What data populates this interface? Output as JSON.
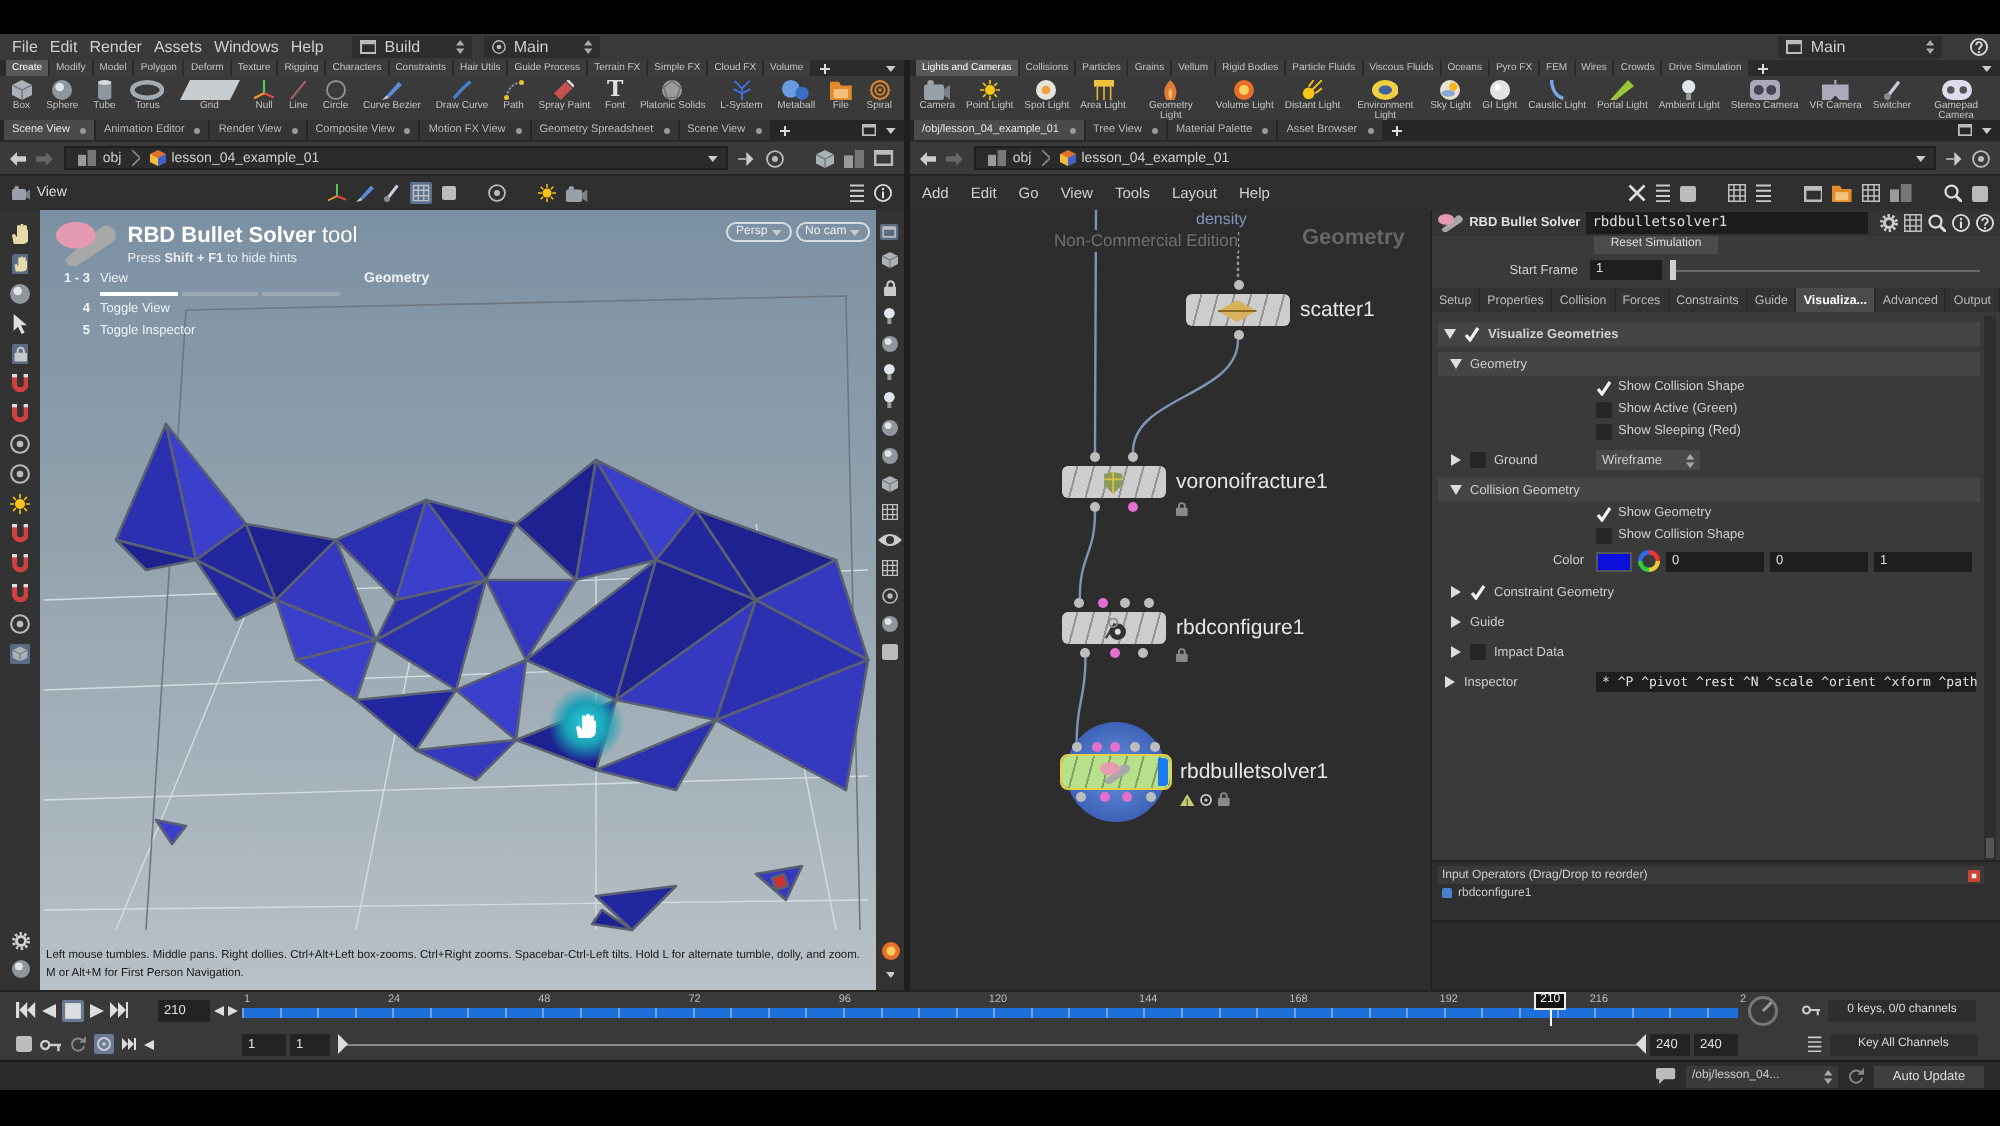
{
  "menubar": {
    "menus": [
      "File",
      "Edit",
      "Render",
      "Assets",
      "Windows",
      "Help"
    ],
    "desktop": "Build",
    "left_context": "Main",
    "right_context": "Main"
  },
  "shelf_left": {
    "tabs": [
      {
        "label": "Create",
        "selected": true
      },
      {
        "label": "Modify",
        "selected": false
      },
      {
        "label": "Model",
        "selected": false
      },
      {
        "label": "Polygon",
        "selected": false
      },
      {
        "label": "Deform",
        "selected": false
      },
      {
        "label": "Texture",
        "selected": false
      },
      {
        "label": "Rigging",
        "selected": false
      },
      {
        "label": "Characters",
        "selected": false
      },
      {
        "label": "Constraints",
        "selected": false
      },
      {
        "label": "Hair Utils",
        "selected": false
      },
      {
        "label": "Guide Process",
        "selected": false
      },
      {
        "label": "Terrain FX",
        "selected": false
      },
      {
        "label": "Simple FX",
        "selected": false
      },
      {
        "label": "Cloud FX",
        "selected": false
      },
      {
        "label": "Volume",
        "selected": false
      }
    ],
    "tools": [
      {
        "label": "Box"
      },
      {
        "label": "Sphere"
      },
      {
        "label": "Tube"
      },
      {
        "label": "Torus"
      },
      {
        "label": "Grid"
      },
      {
        "label": "Null"
      },
      {
        "label": "Line"
      },
      {
        "label": "Circle"
      },
      {
        "label": "Curve Bezier"
      },
      {
        "label": "Draw Curve"
      },
      {
        "label": "Path"
      },
      {
        "label": "Spray Paint"
      },
      {
        "label": "Font",
        "glyph": "T"
      },
      {
        "label": "Platonic Solids"
      },
      {
        "label": "L-System"
      },
      {
        "label": "Metaball"
      },
      {
        "label": "File"
      },
      {
        "label": "Spiral"
      }
    ]
  },
  "shelf_right": {
    "tabs": [
      {
        "label": "Lights and Cameras",
        "selected": true
      },
      {
        "label": "Collisions",
        "selected": false
      },
      {
        "label": "Particles",
        "selected": false
      },
      {
        "label": "Grains",
        "selected": false
      },
      {
        "label": "Vellum",
        "selected": false
      },
      {
        "label": "Rigid Bodies",
        "selected": false
      },
      {
        "label": "Particle Fluids",
        "selected": false
      },
      {
        "label": "Viscous Fluids",
        "selected": false
      },
      {
        "label": "Oceans",
        "selected": false
      },
      {
        "label": "Pyro FX",
        "selected": false
      },
      {
        "label": "FEM",
        "selected": false
      },
      {
        "label": "Wires",
        "selected": false
      },
      {
        "label": "Crowds",
        "selected": false
      },
      {
        "label": "Drive Simulation",
        "selected": false
      }
    ],
    "tools": [
      {
        "label": "Camera"
      },
      {
        "label": "Point Light"
      },
      {
        "label": "Spot Light"
      },
      {
        "label": "Area Light"
      },
      {
        "label": "Geometry Light"
      },
      {
        "label": "Volume Light"
      },
      {
        "label": "Distant Light"
      },
      {
        "label": "Environment Light"
      },
      {
        "label": "Sky Light"
      },
      {
        "label": "GI Light"
      },
      {
        "label": "Caustic Light"
      },
      {
        "label": "Portal Light"
      },
      {
        "label": "Ambient Light"
      },
      {
        "label": "Stereo Camera"
      },
      {
        "label": "VR Camera"
      },
      {
        "label": "Switcher"
      },
      {
        "label": "Gamepad Camera"
      }
    ]
  },
  "pane_left": {
    "tabs": [
      {
        "label": "Scene View",
        "selected": true
      },
      {
        "label": "Animation Editor",
        "selected": false
      },
      {
        "label": "Render View",
        "selected": false
      },
      {
        "label": "Composite View",
        "selected": false
      },
      {
        "label": "Motion FX View",
        "selected": false
      },
      {
        "label": "Geometry Spreadsheet",
        "selected": false
      },
      {
        "label": "Scene View",
        "selected": false
      }
    ],
    "path": [
      "obj",
      "lesson_04_example_01"
    ],
    "toolbar_title": "View"
  },
  "pane_right": {
    "tabs": [
      {
        "label": "/obj/lesson_04_example_01",
        "selected": true
      },
      {
        "label": "Tree View",
        "selected": false
      },
      {
        "label": "Material Palette",
        "selected": false
      },
      {
        "label": "Asset Browser",
        "selected": false
      }
    ],
    "path": [
      "obj",
      "lesson_04_example_01"
    ],
    "menus": [
      "Add",
      "Edit",
      "Go",
      "View",
      "Tools",
      "Layout",
      "Help"
    ]
  },
  "viewport": {
    "tool_hint": {
      "title": "**RBD Bullet Solver** tool",
      "subtitle": "Press **Shift + F1** to hide hints",
      "hotkeys": [
        {
          "keys": "1 - 3",
          "action": "View"
        },
        {
          "keys": "4",
          "action": "Toggle View"
        },
        {
          "keys": "5",
          "action": "Toggle Inspector"
        }
      ],
      "modes": [
        {
          "selected": true
        },
        {
          "selected": false
        },
        {
          "selected": false
        }
      ],
      "mode_label": "Geometry"
    },
    "camera_menus": [
      "Persp",
      "No cam"
    ],
    "help_lines": [
      "Left mouse tumbles. Middle pans. Right dollies. Ctrl+Alt+Left box-zooms. Ctrl+Right zooms. Spacebar-Ctrl-Left tilts. Hold L for alternate tumble, dolly, and zoom.",
      "M or Alt+M for First Person Navigation."
    ]
  },
  "network": {
    "partial_label": "density",
    "watermark": "Non-Commercial Edition",
    "context_label": "Geometry",
    "nodes": [
      {
        "name": "scatter1",
        "color": "#cdcdcd",
        "selected": false,
        "display": false,
        "locked": false,
        "simulation": false,
        "time_dependent": false
      },
      {
        "name": "voronoifracture1",
        "color": "#cdcdcd",
        "selected": false,
        "display": false,
        "locked": true,
        "simulation": false,
        "time_dependent": false
      },
      {
        "name": "rbdconfigure1",
        "color": "#cdcdcd",
        "selected": false,
        "display": false,
        "locked": true,
        "simulation": false,
        "time_dependent": false
      },
      {
        "name": "rbdbulletsolver1",
        "color": "#b7e08a",
        "selected": true,
        "display": true,
        "locked": true,
        "simulation": true,
        "time_dependent": true
      }
    ]
  },
  "parameters": {
    "node_type": "RBD Bullet Solver",
    "node_name": "rbdbulletsolver1",
    "reset_button": "Reset Simulation",
    "start_frame": {
      "label": "Start Frame",
      "value": "1",
      "level": 0
    },
    "tabs": [
      {
        "label": "Setup",
        "selected": false
      },
      {
        "label": "Properties",
        "selected": false
      },
      {
        "label": "Collision",
        "selected": false
      },
      {
        "label": "Forces",
        "selected": false
      },
      {
        "label": "Constraints",
        "selected": false
      },
      {
        "label": "Guide",
        "selected": false
      },
      {
        "label": "Visualiza...",
        "selected": true
      },
      {
        "label": "Advanced",
        "selected": false
      },
      {
        "label": "Output",
        "selected": false
      }
    ],
    "folders": [
      {
        "kind": "toggle_folder",
        "label": "Visualize Geometries",
        "expanded": true,
        "checked": true,
        "children": [
          {
            "kind": "folder",
            "label": "Geometry",
            "expanded": true,
            "children": [
              {
                "kind": "checkbox",
                "label": "Show Collision Shape",
                "checked": true
              },
              {
                "kind": "checkbox",
                "label": "Show Active (Green)",
                "checked": false
              },
              {
                "kind": "checkbox",
                "label": "Show Sleeping (Red)",
                "checked": false
              }
            ]
          },
          {
            "kind": "toggle_folder",
            "label": "Ground",
            "expanded": false,
            "checked": false,
            "value": "Wireframe"
          },
          {
            "kind": "folder",
            "label": "Collision Geometry",
            "expanded": true,
            "children": [
              {
                "kind": "checkbox",
                "label": "Show Geometry",
                "checked": true
              },
              {
                "kind": "checkbox",
                "label": "Show Collision Shape",
                "checked": false
              },
              {
                "kind": "color",
                "label": "Color",
                "color": "#0b10dc",
                "values": [
                  "0",
                  "0",
                  "1"
                ]
              }
            ]
          },
          {
            "kind": "toggle_folder",
            "label": "Constraint Geometry",
            "expanded": false,
            "checked": true
          },
          {
            "kind": "folder",
            "label": "Guide",
            "expanded": false
          },
          {
            "kind": "toggle_folder",
            "label": "Impact Data",
            "expanded": false,
            "checked": false
          }
        ]
      },
      {
        "kind": "field_folder",
        "label": "Inspector",
        "expanded": false,
        "value": "* ^P ^pivot ^rest ^N ^scale ^orient ^xform ^path"
      }
    ],
    "inputs": {
      "title": "Input Operators (Drag/Drop to reorder)",
      "items": [
        "rbdconfigure1"
      ]
    }
  },
  "timeline": {
    "frame": "210",
    "level": 0.8745,
    "playhead_label": "210",
    "ticks": [
      "1",
      "24",
      "48",
      "72",
      "96",
      "120",
      "144",
      "168",
      "192",
      "216",
      "2"
    ],
    "keys_status": "0 keys, 0/0 channels",
    "key_button": "Key All Channels",
    "range": [
      "1",
      "1",
      "240",
      "240"
    ],
    "range_slider": {
      "level": 1
    }
  },
  "status_bar": {
    "path": "/obj/lesson_04...",
    "update_mode": "Auto Update"
  }
}
